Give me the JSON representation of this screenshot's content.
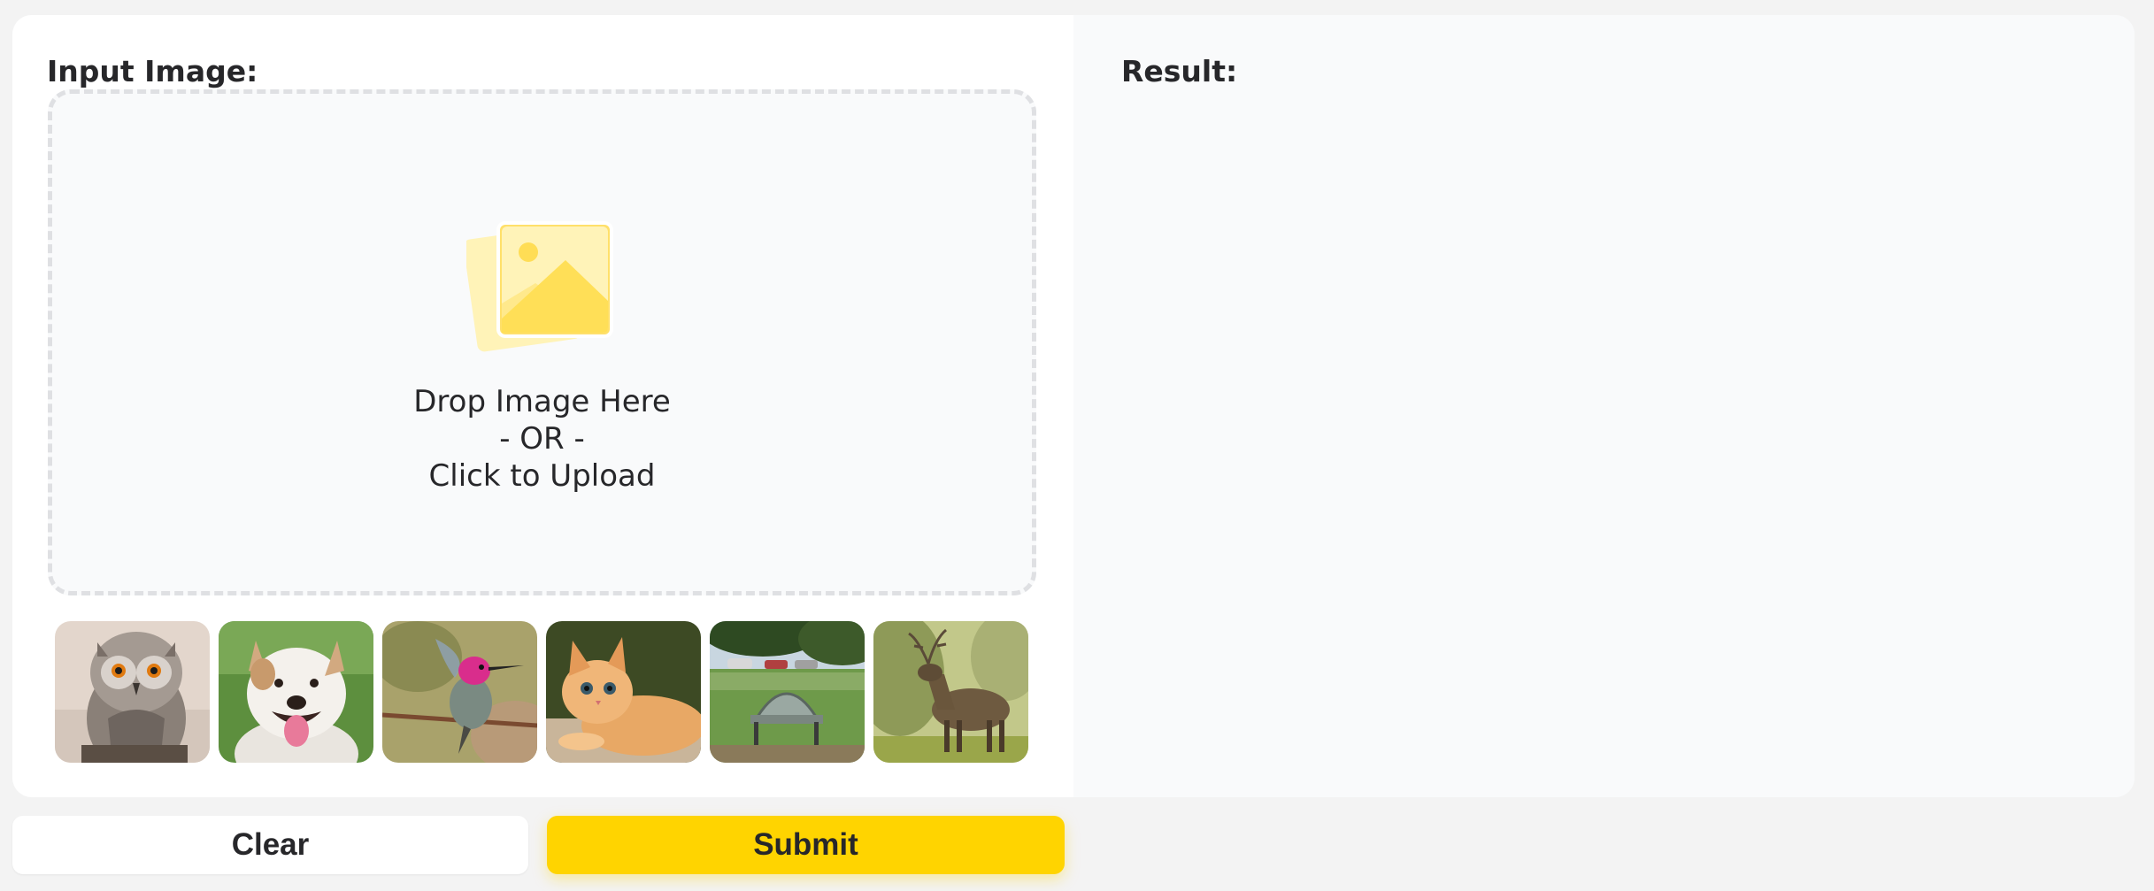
{
  "input_panel": {
    "label": "Input Image:",
    "dropzone": {
      "line1": "Drop Image Here",
      "line2": "- OR -",
      "line3": "Click to Upload",
      "icon": "image-upload-icon"
    }
  },
  "result_panel": {
    "label": "Result:"
  },
  "examples": [
    {
      "subject": "owl"
    },
    {
      "subject": "dog"
    },
    {
      "subject": "hummingbird"
    },
    {
      "subject": "kitten"
    },
    {
      "subject": "park bench"
    },
    {
      "subject": "deer"
    }
  ],
  "buttons": {
    "clear_label": "Clear",
    "submit_label": "Submit"
  },
  "colors": {
    "accent": "#ffd400",
    "background": "#f3f3f3",
    "panel_left": "#ffffff",
    "panel_right": "#f9fafb",
    "dropzone_border": "#dfe0e3"
  }
}
